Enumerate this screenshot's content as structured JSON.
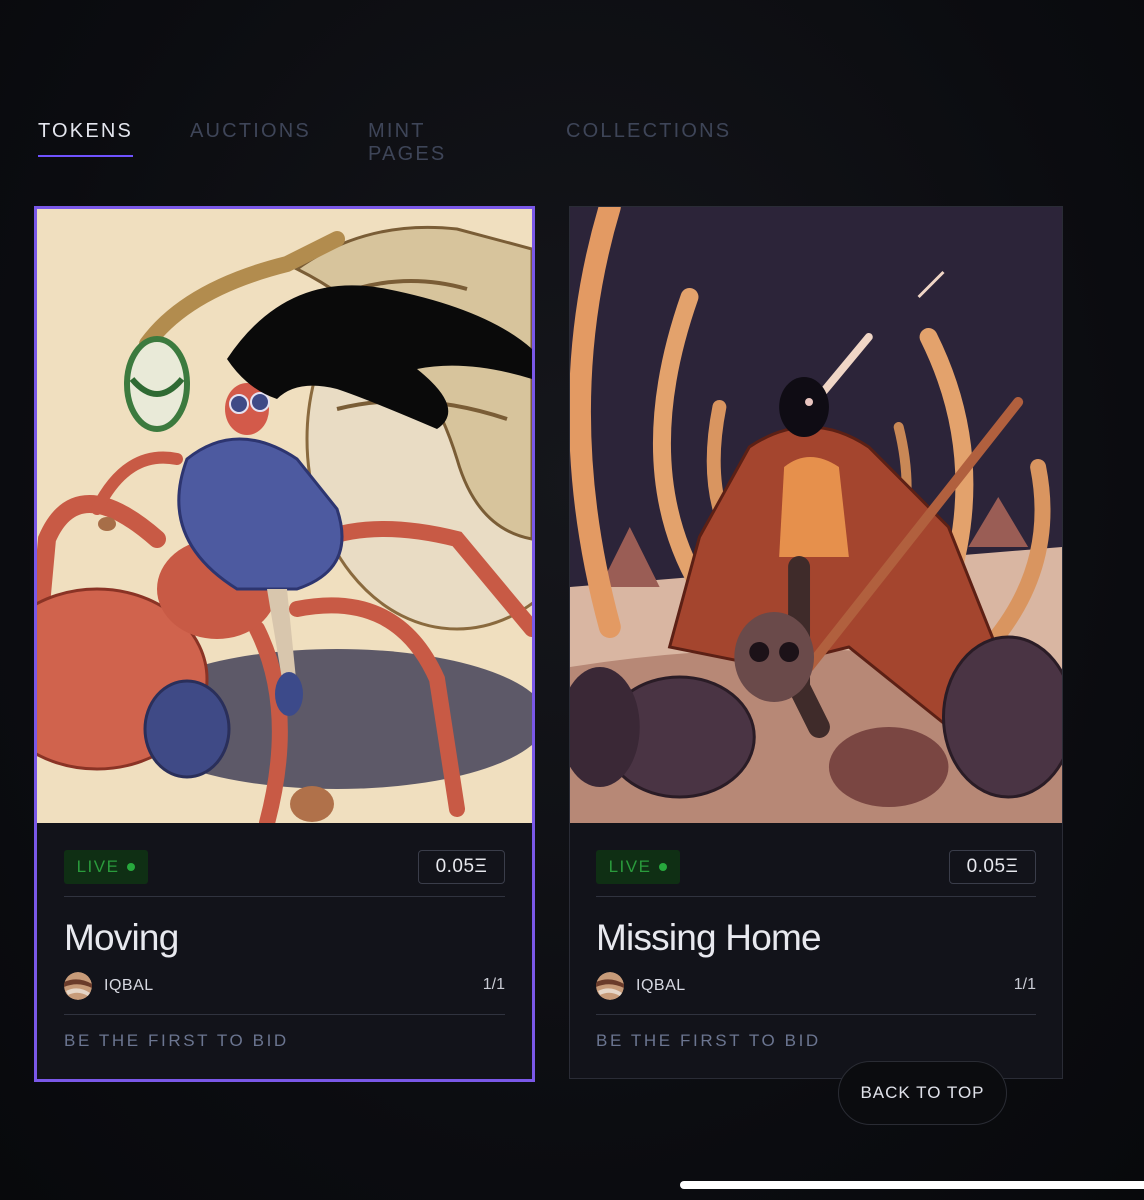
{
  "tabs": [
    {
      "label": "TOKENS",
      "active": true
    },
    {
      "label": "AUCTIONS",
      "active": false
    },
    {
      "label": "MINT PAGES",
      "active": false
    },
    {
      "label": "COLLECTIONS",
      "active": false
    }
  ],
  "cards": [
    {
      "status": "LIVE",
      "price": "0.05Ξ",
      "title": "Moving",
      "artist": "IQBAL",
      "edition": "1/1",
      "bid_note": "BE THE FIRST TO BID",
      "selected": true
    },
    {
      "status": "LIVE",
      "price": "0.05Ξ",
      "title": "Missing Home",
      "artist": "IQBAL",
      "edition": "1/1",
      "bid_note": "BE THE FIRST TO BID",
      "selected": false
    }
  ],
  "back_to_top_label": "BACK TO TOP",
  "colors": {
    "accent": "#7a58e8",
    "live_green": "#27a83d",
    "background": "#0d0e12"
  }
}
